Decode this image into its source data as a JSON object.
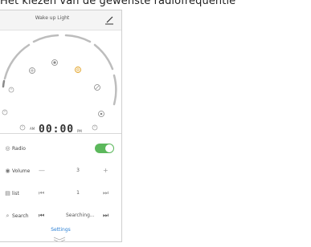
{
  "caption": "Het kiezen van de gewenste radiofrequentie",
  "app": {
    "title": "Wake up Light",
    "edit_icon": "pen-icon"
  },
  "clock": {
    "display": "00:00",
    "am_label": "AM",
    "pm_label": "PM",
    "accent_color": "#e0a020"
  },
  "radio": {
    "label": "Radio",
    "enabled": true,
    "toggle_color": "#5cb85c"
  },
  "volume": {
    "label": "Volume",
    "minus": "—",
    "value": "3",
    "plus": "+"
  },
  "list": {
    "label": "list",
    "prev": "⏮",
    "value": "1",
    "next": "⏭"
  },
  "search": {
    "label": "Search",
    "prev": "⏮",
    "status": "Searching...",
    "next": "⏭"
  },
  "settings": {
    "label": "Settings"
  },
  "icons": {
    "radio": "radio-icon",
    "volume": "speaker-icon",
    "list": "list-icon",
    "search": "search-icon",
    "collapse": "chevron-down-icon"
  }
}
